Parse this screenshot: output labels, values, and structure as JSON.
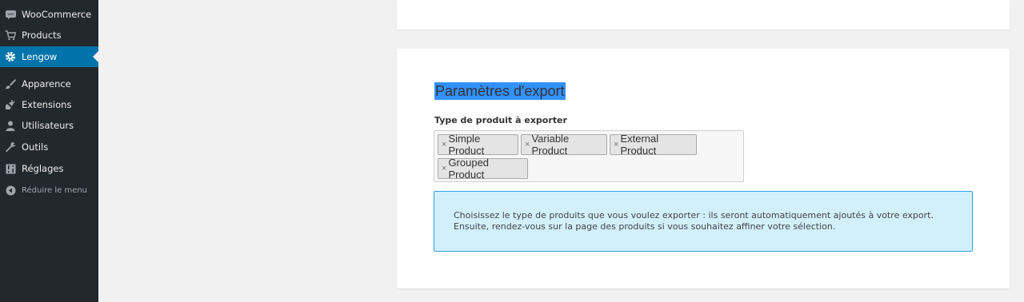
{
  "sidebar": {
    "items": [
      {
        "label": "WooCommerce",
        "icon": "woocommerce-icon"
      },
      {
        "label": "Products",
        "icon": "cart-icon"
      },
      {
        "label": "Lengow",
        "icon": "gear-icon",
        "active": true
      },
      {
        "label": "Apparence",
        "icon": "paintbrush-icon"
      },
      {
        "label": "Extensions",
        "icon": "plugin-icon"
      },
      {
        "label": "Utilisateurs",
        "icon": "user-icon"
      },
      {
        "label": "Outils",
        "icon": "wrench-icon"
      },
      {
        "label": "Réglages",
        "icon": "settings-icon"
      }
    ],
    "collapse_label": "Réduire le menu",
    "active_color": "#0073aa",
    "background": "#23282d"
  },
  "main": {
    "section_title": "Paramètres d'export",
    "field_label": "Type de produit à exporter",
    "remove_symbol": "×",
    "tags": [
      "Simple Product",
      "Variable Product",
      "External Product",
      "Grouped Product"
    ],
    "info": {
      "line1": "Choisissez le type de produits que vous voulez exporter : ils seront automatiquement ajoutés à votre export.",
      "line2": "Ensuite, rendez-vous sur la page des produits si vous souhaitez affiner votre sélection."
    }
  }
}
